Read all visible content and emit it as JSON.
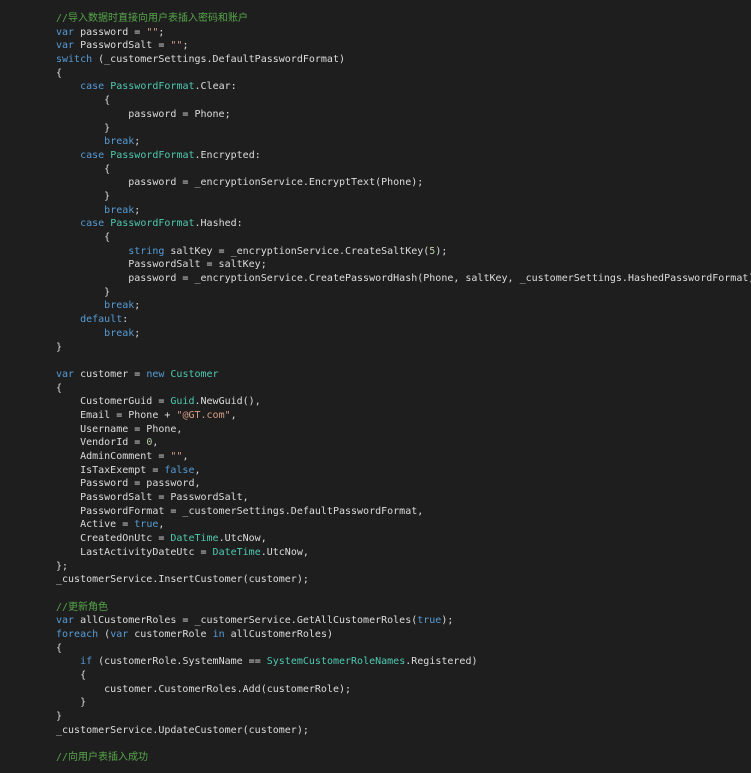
{
  "colors": {
    "background": "#1e1e1e",
    "plain": "#dcdcdc",
    "keyword": "#569cd6",
    "type": "#4ec9b0",
    "string": "#d69d85",
    "comment": "#57a64a",
    "number": "#b5cea8"
  },
  "lines": [
    [
      {
        "t": "cm",
        "v": "//导入数据时直接向用户表插入密码和账户"
      }
    ],
    [
      {
        "t": "kw",
        "v": "var"
      },
      {
        "t": "pl",
        "v": " password = "
      },
      {
        "t": "st",
        "v": "\"\""
      },
      {
        "t": "pl",
        "v": ";"
      }
    ],
    [
      {
        "t": "kw",
        "v": "var"
      },
      {
        "t": "pl",
        "v": " PasswordSalt = "
      },
      {
        "t": "st",
        "v": "\"\""
      },
      {
        "t": "pl",
        "v": ";"
      }
    ],
    [
      {
        "t": "kw",
        "v": "switch"
      },
      {
        "t": "pl",
        "v": " (_customerSettings.DefaultPasswordFormat)"
      }
    ],
    [
      {
        "t": "pl",
        "v": "{"
      }
    ],
    [
      {
        "t": "pl",
        "v": "    "
      },
      {
        "t": "kw",
        "v": "case"
      },
      {
        "t": "pl",
        "v": " "
      },
      {
        "t": "ty",
        "v": "PasswordFormat"
      },
      {
        "t": "pl",
        "v": ".Clear:"
      }
    ],
    [
      {
        "t": "pl",
        "v": "        {"
      }
    ],
    [
      {
        "t": "pl",
        "v": "            password = Phone;"
      }
    ],
    [
      {
        "t": "pl",
        "v": "        }"
      }
    ],
    [
      {
        "t": "pl",
        "v": "        "
      },
      {
        "t": "kw",
        "v": "break"
      },
      {
        "t": "pl",
        "v": ";"
      }
    ],
    [
      {
        "t": "pl",
        "v": "    "
      },
      {
        "t": "kw",
        "v": "case"
      },
      {
        "t": "pl",
        "v": " "
      },
      {
        "t": "ty",
        "v": "PasswordFormat"
      },
      {
        "t": "pl",
        "v": ".Encrypted:"
      }
    ],
    [
      {
        "t": "pl",
        "v": "        {"
      }
    ],
    [
      {
        "t": "pl",
        "v": "            password = _encryptionService.EncryptText(Phone);"
      }
    ],
    [
      {
        "t": "pl",
        "v": "        }"
      }
    ],
    [
      {
        "t": "pl",
        "v": "        "
      },
      {
        "t": "kw",
        "v": "break"
      },
      {
        "t": "pl",
        "v": ";"
      }
    ],
    [
      {
        "t": "pl",
        "v": "    "
      },
      {
        "t": "kw",
        "v": "case"
      },
      {
        "t": "pl",
        "v": " "
      },
      {
        "t": "ty",
        "v": "PasswordFormat"
      },
      {
        "t": "pl",
        "v": ".Hashed:"
      }
    ],
    [
      {
        "t": "pl",
        "v": "        {"
      }
    ],
    [
      {
        "t": "pl",
        "v": "            "
      },
      {
        "t": "kw",
        "v": "string"
      },
      {
        "t": "pl",
        "v": " saltKey = _encryptionService.CreateSaltKey("
      },
      {
        "t": "nm",
        "v": "5"
      },
      {
        "t": "pl",
        "v": ");"
      }
    ],
    [
      {
        "t": "pl",
        "v": "            PasswordSalt = saltKey;"
      }
    ],
    [
      {
        "t": "pl",
        "v": "            password = _encryptionService.CreatePasswordHash(Phone, saltKey, _customerSettings.HashedPasswordFormat);"
      }
    ],
    [
      {
        "t": "pl",
        "v": "        }"
      }
    ],
    [
      {
        "t": "pl",
        "v": "        "
      },
      {
        "t": "kw",
        "v": "break"
      },
      {
        "t": "pl",
        "v": ";"
      }
    ],
    [
      {
        "t": "pl",
        "v": "    "
      },
      {
        "t": "kw",
        "v": "default"
      },
      {
        "t": "pl",
        "v": ":"
      }
    ],
    [
      {
        "t": "pl",
        "v": "        "
      },
      {
        "t": "kw",
        "v": "break"
      },
      {
        "t": "pl",
        "v": ";"
      }
    ],
    [
      {
        "t": "pl",
        "v": "}"
      }
    ],
    [],
    [
      {
        "t": "kw",
        "v": "var"
      },
      {
        "t": "pl",
        "v": " customer = "
      },
      {
        "t": "kw",
        "v": "new"
      },
      {
        "t": "pl",
        "v": " "
      },
      {
        "t": "ty",
        "v": "Customer"
      }
    ],
    [
      {
        "t": "pl",
        "v": "{"
      }
    ],
    [
      {
        "t": "pl",
        "v": "    CustomerGuid = "
      },
      {
        "t": "ty",
        "v": "Guid"
      },
      {
        "t": "pl",
        "v": ".NewGuid(),"
      }
    ],
    [
      {
        "t": "pl",
        "v": "    Email = Phone + "
      },
      {
        "t": "st",
        "v": "\"@GT.com\""
      },
      {
        "t": "pl",
        "v": ","
      }
    ],
    [
      {
        "t": "pl",
        "v": "    Username = Phone,"
      }
    ],
    [
      {
        "t": "pl",
        "v": "    VendorId = "
      },
      {
        "t": "nm",
        "v": "0"
      },
      {
        "t": "pl",
        "v": ","
      }
    ],
    [
      {
        "t": "pl",
        "v": "    AdminComment = "
      },
      {
        "t": "st",
        "v": "\"\""
      },
      {
        "t": "pl",
        "v": ","
      }
    ],
    [
      {
        "t": "pl",
        "v": "    IsTaxExempt = "
      },
      {
        "t": "kw",
        "v": "false"
      },
      {
        "t": "pl",
        "v": ","
      }
    ],
    [
      {
        "t": "pl",
        "v": "    Password = password,"
      }
    ],
    [
      {
        "t": "pl",
        "v": "    PasswordSalt = PasswordSalt,"
      }
    ],
    [
      {
        "t": "pl",
        "v": "    PasswordFormat = _customerSettings.DefaultPasswordFormat,"
      }
    ],
    [
      {
        "t": "pl",
        "v": "    Active = "
      },
      {
        "t": "kw",
        "v": "true"
      },
      {
        "t": "pl",
        "v": ","
      }
    ],
    [
      {
        "t": "pl",
        "v": "    CreatedOnUtc = "
      },
      {
        "t": "ty",
        "v": "DateTime"
      },
      {
        "t": "pl",
        "v": ".UtcNow,"
      }
    ],
    [
      {
        "t": "pl",
        "v": "    LastActivityDateUtc = "
      },
      {
        "t": "ty",
        "v": "DateTime"
      },
      {
        "t": "pl",
        "v": ".UtcNow,"
      }
    ],
    [
      {
        "t": "pl",
        "v": "};"
      }
    ],
    [
      {
        "t": "pl",
        "v": "_customerService.InsertCustomer(customer);"
      }
    ],
    [],
    [
      {
        "t": "cm",
        "v": "//更新角色"
      }
    ],
    [
      {
        "t": "kw",
        "v": "var"
      },
      {
        "t": "pl",
        "v": " allCustomerRoles = _customerService.GetAllCustomerRoles("
      },
      {
        "t": "kw",
        "v": "true"
      },
      {
        "t": "pl",
        "v": ");"
      }
    ],
    [
      {
        "t": "kw",
        "v": "foreach"
      },
      {
        "t": "pl",
        "v": " ("
      },
      {
        "t": "kw",
        "v": "var"
      },
      {
        "t": "pl",
        "v": " customerRole "
      },
      {
        "t": "kw",
        "v": "in"
      },
      {
        "t": "pl",
        "v": " allCustomerRoles)"
      }
    ],
    [
      {
        "t": "pl",
        "v": "{"
      }
    ],
    [
      {
        "t": "pl",
        "v": "    "
      },
      {
        "t": "kw",
        "v": "if"
      },
      {
        "t": "pl",
        "v": " (customerRole.SystemName == "
      },
      {
        "t": "ty",
        "v": "SystemCustomerRoleNames"
      },
      {
        "t": "pl",
        "v": ".Registered)"
      }
    ],
    [
      {
        "t": "pl",
        "v": "    {"
      }
    ],
    [
      {
        "t": "pl",
        "v": "        customer.CustomerRoles.Add(customerRole);"
      }
    ],
    [
      {
        "t": "pl",
        "v": "    }"
      }
    ],
    [
      {
        "t": "pl",
        "v": "}"
      }
    ],
    [
      {
        "t": "pl",
        "v": "_customerService.UpdateCustomer(customer);"
      }
    ],
    [],
    [
      {
        "t": "cm",
        "v": "//向用户表插入成功"
      }
    ]
  ]
}
